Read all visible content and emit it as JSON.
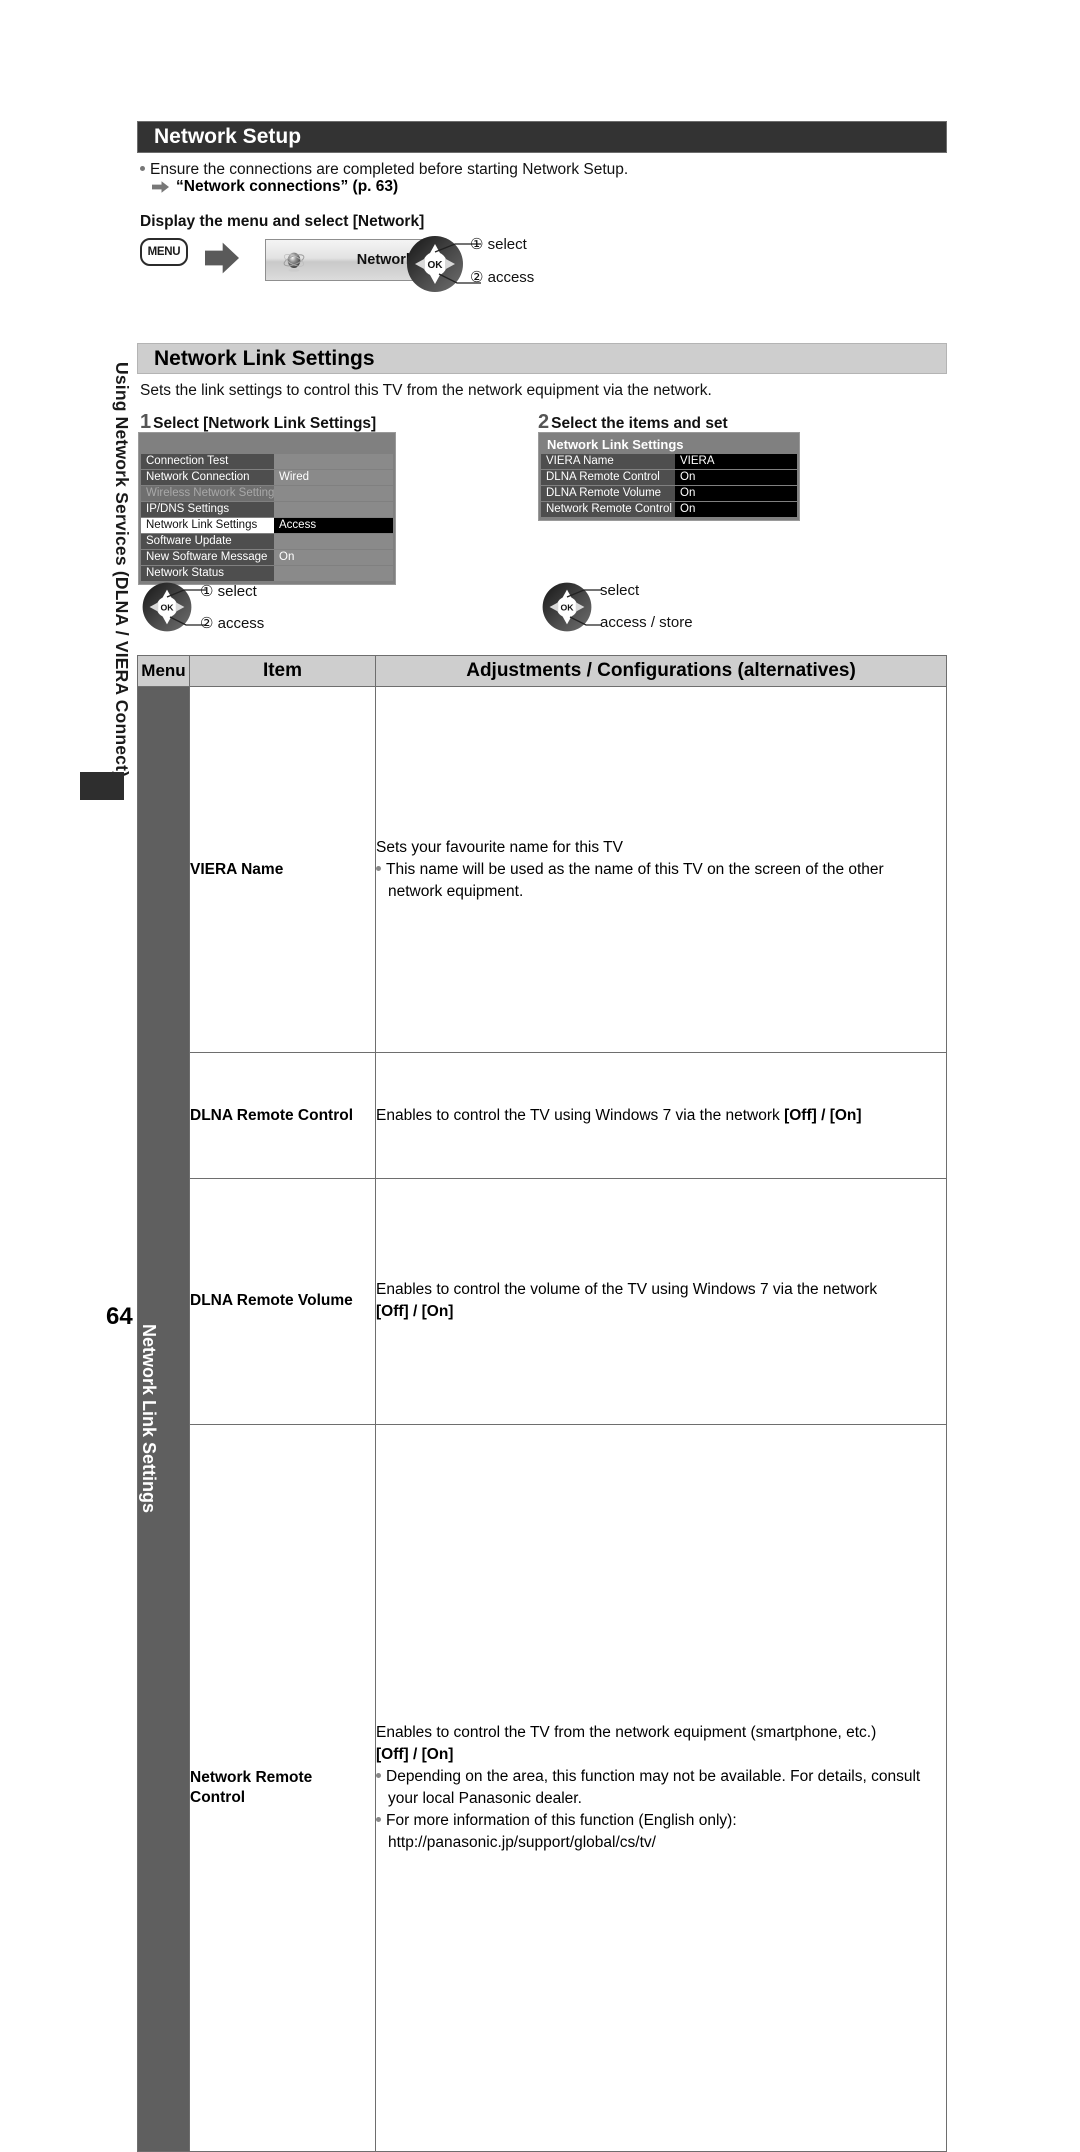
{
  "page": {
    "number": "64",
    "side_tab_label": "Using Network Services (DLNA / VIERA Connect)"
  },
  "section_network_setup": {
    "heading": "Network Setup",
    "bullet": "Ensure the connections are completed before starting Network Setup.",
    "reference": "“Network connections” (p. 63)",
    "instruction": "Display the menu and select [Network]",
    "menu_button_label": "MENU",
    "network_tile_label": "Network",
    "dpad_callout_1": "① select",
    "dpad_callout_2": "② access"
  },
  "section_network_link_settings": {
    "heading": "Network Link Settings",
    "description": "Sets the link settings to control this TV from the network equipment via the network.",
    "step1": {
      "number": "1",
      "title": "Select [Network Link Settings]",
      "callout_1": "① select",
      "callout_2": "② access",
      "menu_title": "",
      "rows": [
        {
          "label": "Connection Test",
          "value": "",
          "state": "normal"
        },
        {
          "label": "Network Connection",
          "value": "Wired",
          "state": "normal"
        },
        {
          "label": "Wireless Network Settings",
          "value": "",
          "state": "dim"
        },
        {
          "label": "IP/DNS Settings",
          "value": "",
          "state": "normal"
        },
        {
          "label": "Network Link Settings",
          "value": "Access",
          "state": "selected"
        },
        {
          "label": "Software Update",
          "value": "",
          "state": "normal"
        },
        {
          "label": "New Software Message",
          "value": "On",
          "state": "normal"
        },
        {
          "label": "Network Status",
          "value": "",
          "state": "normal"
        }
      ]
    },
    "step2": {
      "number": "2",
      "title": "Select the items and set",
      "callout_1": "select",
      "callout_2": "access / store",
      "menu_title": "Network Link Settings",
      "rows": [
        {
          "label": "VIERA Name",
          "value": "VIERA",
          "state": "dark"
        },
        {
          "label": "DLNA Remote Control",
          "value": "On",
          "state": "dark"
        },
        {
          "label": "DLNA Remote Volume",
          "value": "On",
          "state": "dark"
        },
        {
          "label": "Network Remote Control",
          "value": "On",
          "state": "dark"
        }
      ]
    }
  },
  "table": {
    "headers": {
      "menu": "Menu",
      "item": "Item",
      "adjustments": "Adjustments / Configurations (alternatives)"
    },
    "menu_group_label": "Network Link Settings",
    "rows": [
      {
        "item": "VIERA Name",
        "lines": [
          {
            "type": "plain",
            "text": "Sets your favourite name for this TV"
          },
          {
            "type": "bullet",
            "text": "This name will be used as the name of this TV on the screen of the other"
          },
          {
            "type": "cont",
            "text": "network equipment."
          }
        ]
      },
      {
        "item": "DLNA Remote Control",
        "lines": [
          {
            "type": "plain_bold_tail",
            "text": "Enables to control the TV using Windows 7 via the network ",
            "bold": "[Off] / [On]"
          }
        ]
      },
      {
        "item": "DLNA Remote Volume",
        "lines": [
          {
            "type": "plain",
            "text": "Enables to control the volume of the TV using Windows 7 via the network"
          },
          {
            "type": "bold",
            "text": "[Off] / [On]"
          }
        ]
      },
      {
        "item": "Network Remote\nControl",
        "item_line1": "Network Remote",
        "item_line2": "Control",
        "lines": [
          {
            "type": "plain",
            "text": "Enables to control the TV from the network equipment (smartphone, etc.)"
          },
          {
            "type": "bold",
            "text": "[Off] / [On]"
          },
          {
            "type": "bullet",
            "text": "Depending on the area, this function may not be available. For details, consult"
          },
          {
            "type": "cont",
            "text": "your local Panasonic dealer."
          },
          {
            "type": "bullet",
            "text": "For more information of this function (English only):"
          },
          {
            "type": "cont",
            "text": "http://panasonic.jp/support/global/cs/tv/"
          }
        ]
      }
    ]
  },
  "colors": {
    "dark_bar": "#333333",
    "light_bar": "#cecece",
    "menu_cell": "#5f5f5f",
    "tv_menu_bg": "#808080"
  }
}
